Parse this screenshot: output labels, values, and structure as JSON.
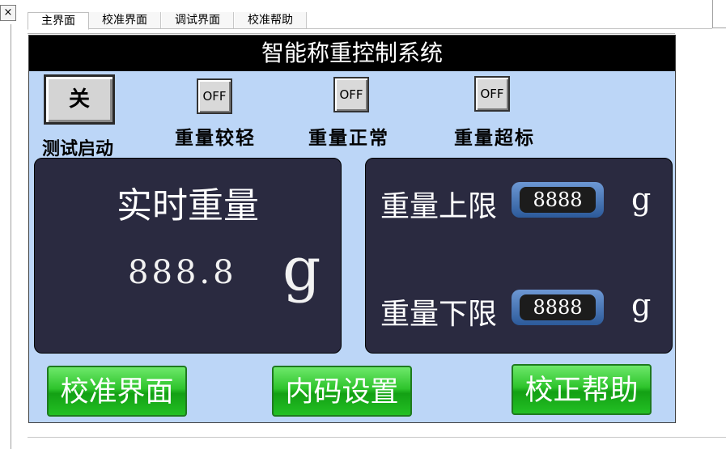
{
  "editor": {
    "close_glyph": "×",
    "tabs": [
      "主界面",
      "校准界面",
      "调试界面",
      "校准帮助"
    ]
  },
  "screen": {
    "title": "智能称重控制系统",
    "test_button_label": "关",
    "test_label": "测试启动",
    "indicators": [
      {
        "state": "OFF",
        "label": "重量较轻"
      },
      {
        "state": "OFF",
        "label": "重量正常"
      },
      {
        "state": "OFF",
        "label": "重量超标"
      }
    ],
    "realtime": {
      "title": "实时重量",
      "value": "888.8",
      "unit": "g"
    },
    "limits": {
      "upper_label": "重量上限",
      "upper_value": "8888",
      "upper_unit": "g",
      "lower_label": "重量下限",
      "lower_value": "8888",
      "lower_unit": "g"
    },
    "buttons": {
      "calib": "校准界面",
      "code": "内码设置",
      "help": "校正帮助"
    }
  },
  "colors": {
    "screen_bg": "#bcd6f7",
    "panel_bg": "#2a2a40",
    "title_bg": "#000000",
    "button_green": "#2ec42c"
  }
}
